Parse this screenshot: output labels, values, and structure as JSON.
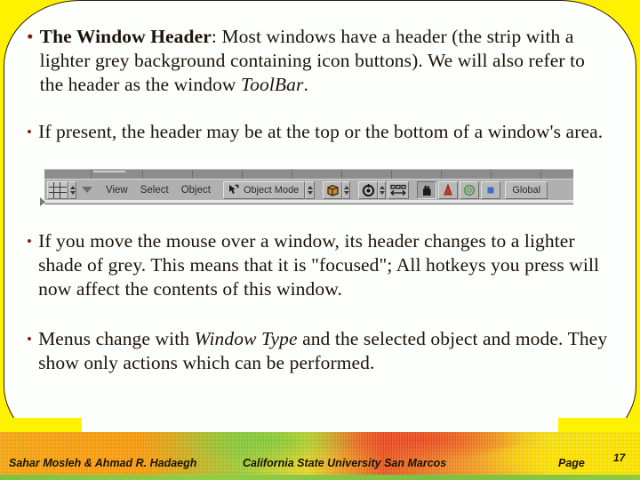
{
  "slide": {
    "background_color": "#FFF200",
    "panel_color": "#FCFFFC",
    "bullet_color": "#8B1A11",
    "text_color": "#1D1208",
    "bullet_glyph": "•"
  },
  "bullets": [
    {
      "id": "window-header",
      "lead_bold": "The Window Header",
      "rest": ": Most windows have a header (the strip with a lighter grey background containing icon buttons). We will also refer to the header as the window ",
      "emphasis": "ToolBar",
      "tail": "."
    },
    {
      "id": "header-position",
      "text": "If present, the header may be at the top or the bottom of a window's area."
    },
    {
      "id": "focus-behavior",
      "text": "If you move the mouse over a window, its header changes to a lighter shade of grey. This means that it is \"focused\"; All hotkeys you press will now affect the contents of this window."
    },
    {
      "id": "menus-change",
      "pre": "Menus change with ",
      "emphasis": "Window Type",
      "post": " and the selected object and mode. They show only actions which can be performed."
    }
  ],
  "toolbar": {
    "caption": "blender-window-header-screenshot",
    "window_type_icon": "grid-icon",
    "dropdown_icon": "triangle-down-icon",
    "menus": [
      "View",
      "Select",
      "Object"
    ],
    "mode_selector": {
      "icon": "object-mode-cursor-icon",
      "label": "Object Mode",
      "spinner": "up-down-spinner-icon"
    },
    "draw_type": {
      "icon": "shading-solid-icon",
      "spinner": "up-down-spinner-icon"
    },
    "rotation_widget": {
      "icon": "pivot-median-point-icon",
      "spinner": "up-down-spinner-icon"
    },
    "layer_icon": "layers-icon",
    "manipulator_buttons": [
      {
        "name": "translate-manipulator",
        "icon": "hand-icon",
        "active": true
      },
      {
        "name": "rotate-manipulator",
        "icon": "cone-icon",
        "active": false
      },
      {
        "name": "scale-manipulator",
        "icon": "circle-ring-icon",
        "active": false
      },
      {
        "name": "manipulator-toggle",
        "icon": "square-icon",
        "active": false
      }
    ],
    "orientation": {
      "label": "Global",
      "name": "transform-orientation-select"
    }
  },
  "footer": {
    "authors": "Sahar Mosleh & Ahmad R. Hadaegh",
    "institution": "California State University San Marcos",
    "page_label": "Page",
    "page_number": "17"
  }
}
